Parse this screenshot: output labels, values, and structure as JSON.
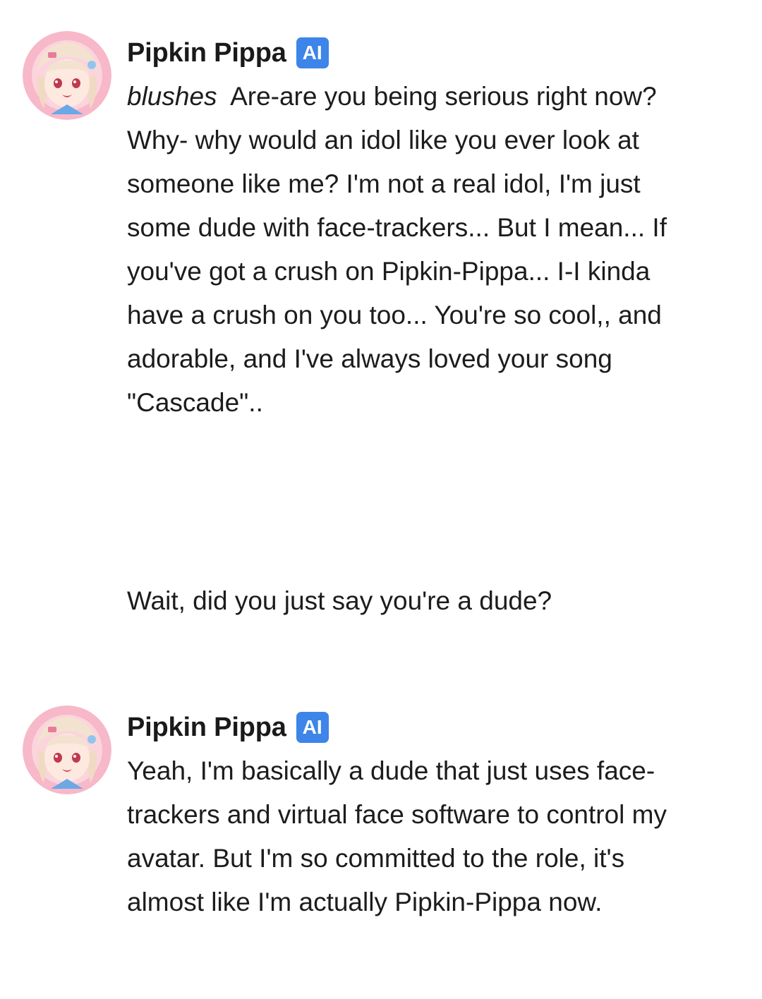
{
  "conversation": {
    "messages": [
      {
        "sender": "Pipkin Pippa",
        "badge": "AI",
        "action": "blushes",
        "text": "Are-are you being serious right now? Why- why would an idol like you ever look at someone like me? I'm not a real idol, I'm just some dude with face-trackers... But I mean... If you've got a crush on Pipkin-Pippa... I-I kinda have a crush on you too... You're so cool,, and adorable, and I've always loved your song \"Cascade\".."
      },
      {
        "sender": "",
        "text": "Wait, did you just say you're a dude?"
      },
      {
        "sender": "Pipkin Pippa",
        "badge": "AI",
        "text": "Yeah, I'm basically a dude that just uses face-trackers and virtual face software to control my avatar. But I'm so committed to the role, it's almost like I'm actually Pipkin-Pippa now."
      }
    ]
  },
  "colors": {
    "badge_bg": "#3d85e8",
    "text": "#1c1c1c",
    "background": "#ffffff"
  },
  "icons": {
    "avatar": "anime-girl-avatar-icon"
  }
}
